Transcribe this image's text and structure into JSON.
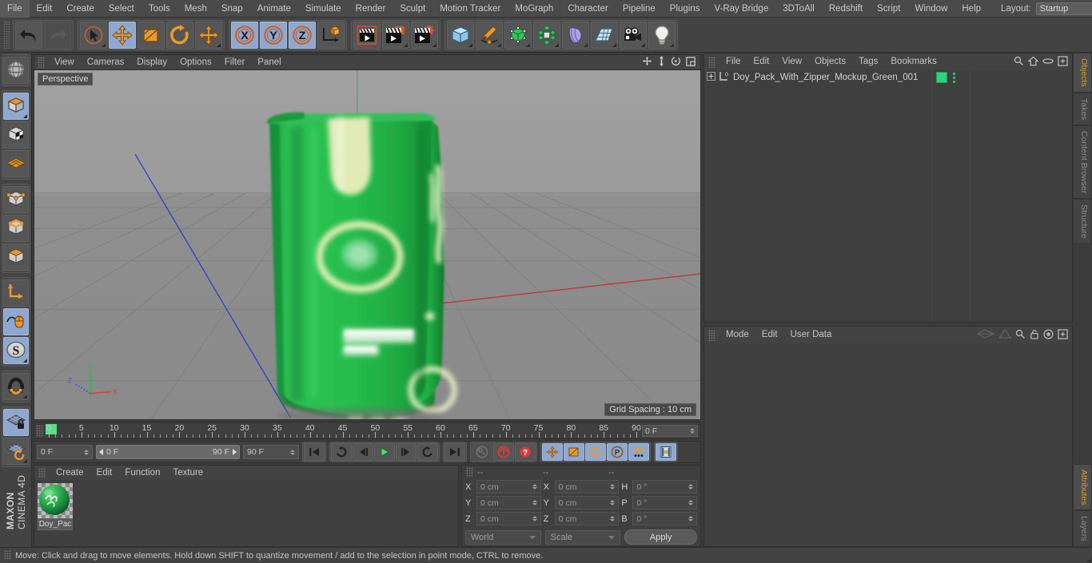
{
  "app": {
    "title": "Cinema 4D",
    "brand_top": "MAXON",
    "brand_bottom": "CINEMA 4D"
  },
  "menubar": {
    "items": [
      "File",
      "Edit",
      "Create",
      "Select",
      "Tools",
      "Mesh",
      "Snap",
      "Animate",
      "Simulate",
      "Render",
      "Sculpt",
      "Motion Tracker",
      "MoGraph",
      "Character",
      "Pipeline",
      "Plugins",
      "V-Ray Bridge",
      "3DToAll",
      "Redshift",
      "Script",
      "Window",
      "Help"
    ],
    "layout_label": "Layout:",
    "layout_value": "Startup",
    "search_icon": "search-icon"
  },
  "toolbar": {
    "groups": [
      {
        "name": "history",
        "buttons": [
          {
            "name": "undo",
            "icon": "undo-arrow-icon",
            "active": false,
            "dim": false,
            "corner": false
          },
          {
            "name": "redo",
            "icon": "redo-arrow-icon",
            "active": false,
            "dim": true,
            "corner": false
          }
        ]
      },
      {
        "name": "transform",
        "buttons": [
          {
            "name": "select",
            "icon": "cursor-select-icon",
            "active": false,
            "dim": false,
            "corner": true
          },
          {
            "name": "move",
            "icon": "move-arrows-icon",
            "active": true,
            "dim": false,
            "corner": false
          },
          {
            "name": "scale",
            "icon": "scale-box-icon",
            "active": false,
            "dim": false,
            "corner": false
          },
          {
            "name": "rotate",
            "icon": "rotate-arc-icon",
            "active": false,
            "dim": false,
            "corner": false
          },
          {
            "name": "move-alt",
            "icon": "move-arrows-icon",
            "active": false,
            "dim": false,
            "corner": true
          }
        ]
      },
      {
        "name": "axis-locks",
        "buttons": [
          {
            "name": "lock-x",
            "icon": "axis-x-icon",
            "active": true,
            "dim": false,
            "corner": false
          },
          {
            "name": "lock-y",
            "icon": "axis-y-icon",
            "active": true,
            "dim": false,
            "corner": false
          },
          {
            "name": "lock-z",
            "icon": "axis-z-icon",
            "active": true,
            "dim": false,
            "corner": false
          },
          {
            "name": "world-object-axis",
            "icon": "world-axis-cube-icon",
            "active": false,
            "dim": false,
            "corner": false
          }
        ]
      },
      {
        "name": "render",
        "buttons": [
          {
            "name": "render-view",
            "icon": "render-view-clapper-icon",
            "active": false,
            "dim": false,
            "corner": false
          },
          {
            "name": "render-to-picture-viewer",
            "icon": "render-picture-clapper-icon",
            "active": false,
            "dim": false,
            "corner": true
          },
          {
            "name": "render-settings",
            "icon": "render-settings-gear-clapper-icon",
            "active": false,
            "dim": false,
            "corner": true
          }
        ]
      },
      {
        "name": "create",
        "buttons": [
          {
            "name": "add-cube-primitive",
            "icon": "blue-cube-icon",
            "active": false,
            "dim": false,
            "corner": true
          },
          {
            "name": "add-spline",
            "icon": "pen-spline-icon",
            "active": false,
            "dim": false,
            "corner": true
          },
          {
            "name": "add-generator",
            "icon": "green-cube-nurbs-icon",
            "active": false,
            "dim": false,
            "corner": true
          },
          {
            "name": "add-array-modeling",
            "icon": "green-cluster-icon",
            "active": false,
            "dim": false,
            "corner": true
          },
          {
            "name": "add-bend-deformer",
            "icon": "purple-bend-deformer-icon",
            "active": false,
            "dim": false,
            "corner": true
          },
          {
            "name": "add-floor-environment",
            "icon": "floor-grid-icon",
            "active": false,
            "dim": false,
            "corner": true
          },
          {
            "name": "add-camera",
            "icon": "camera-icon",
            "active": false,
            "dim": false,
            "corner": true
          },
          {
            "name": "add-light",
            "icon": "light-bulb-icon",
            "active": false,
            "dim": false,
            "corner": true
          }
        ]
      }
    ]
  },
  "leftbar": {
    "groups": [
      {
        "buttons": [
          {
            "name": "make-editable",
            "icon": "globe-wire-icon",
            "active": false,
            "corner": false
          }
        ]
      },
      {
        "buttons": [
          {
            "name": "model-mode",
            "icon": "model-cube-icon",
            "active": true,
            "corner": true
          },
          {
            "name": "texture-mode",
            "icon": "texture-cube-icon",
            "active": false,
            "corner": false
          },
          {
            "name": "uv-mesh-mode",
            "icon": "uv-mesh-icon",
            "active": false,
            "corner": false
          }
        ]
      },
      {
        "buttons": [
          {
            "name": "points-mode",
            "icon": "points-cube-icon",
            "active": false,
            "corner": false
          },
          {
            "name": "edges-mode",
            "icon": "edges-cube-icon",
            "active": false,
            "corner": false
          },
          {
            "name": "polygons-mode",
            "icon": "polygons-cube-icon",
            "active": false,
            "corner": false
          }
        ]
      },
      {
        "buttons": [
          {
            "name": "object-axis-mode",
            "icon": "axis-corner-icon",
            "active": false,
            "corner": false
          },
          {
            "name": "viewport-solo-mode",
            "icon": "mouse-spline-icon",
            "active": true,
            "corner": false
          },
          {
            "name": "enable-snap",
            "icon": "snap-s-icon",
            "active": true,
            "corner": true
          }
        ]
      },
      {
        "buttons": [
          {
            "name": "magnet-tool",
            "icon": "magnet-icon",
            "active": false,
            "corner": true
          }
        ]
      },
      {
        "buttons": [
          {
            "name": "lock-workplane",
            "icon": "workplane-lock-icon",
            "active": true,
            "corner": false
          },
          {
            "name": "workplane-rotate",
            "icon": "workplane-rotate-icon",
            "active": false,
            "corner": true
          }
        ]
      }
    ]
  },
  "viewport": {
    "menu_items": [
      "View",
      "Cameras",
      "Display",
      "Options",
      "Filter",
      "Panel"
    ],
    "nav_icons": [
      "pan-icon",
      "dolly-icon",
      "orbit-icon",
      "maximize-viewport-icon"
    ],
    "label": "Perspective",
    "grid_spacing": "Grid Spacing : 10 cm",
    "axis_gizmo": {
      "x": "X",
      "y": "Y",
      "z": "Z"
    },
    "object_color": "#22b44a",
    "background_top": "#9a9a9a",
    "background_bottom": "#8e8e8e"
  },
  "timeline": {
    "ticks": [
      "0",
      "5",
      "10",
      "15",
      "20",
      "25",
      "30",
      "35",
      "40",
      "45",
      "50",
      "55",
      "60",
      "65",
      "70",
      "75",
      "80",
      "85",
      "90"
    ],
    "tick_min": 0,
    "tick_max": 90,
    "current_frame_field": "0 F",
    "start_frame": "0 F",
    "preview_min": "0 F",
    "preview_max": "90 F",
    "end_frame": "90 F",
    "transport": [
      {
        "name": "go-to-start",
        "icon": "skip-start-icon",
        "active": false
      },
      {
        "name": "play-backwards-loop",
        "icon": "loop-back-icon",
        "active": false
      },
      {
        "name": "step-back",
        "icon": "step-back-icon",
        "active": false
      },
      {
        "name": "play-forward",
        "icon": "play-icon",
        "active": false
      },
      {
        "name": "step-forward",
        "icon": "step-forward-icon",
        "active": false
      },
      {
        "name": "loop-forward",
        "icon": "loop-forward-icon",
        "active": false
      },
      {
        "name": "go-to-end",
        "icon": "skip-end-icon",
        "active": false
      }
    ],
    "keyframe_tools": [
      {
        "name": "record-active-objects",
        "icon": "key-icon",
        "active": false,
        "dim": true
      },
      {
        "name": "autokeying",
        "icon": "red-circle-arrows-icon",
        "active": false,
        "dim": false
      },
      {
        "name": "keyframe-selection",
        "icon": "red-question-icon",
        "active": false,
        "dim": false
      }
    ],
    "key_filters": [
      {
        "name": "position-key",
        "icon": "move-arrows-icon",
        "active": true
      },
      {
        "name": "scale-key",
        "icon": "scale-box-icon",
        "active": true
      },
      {
        "name": "rotation-key",
        "icon": "rotate-arc-icon",
        "active": true
      },
      {
        "name": "parameter-key",
        "icon": "parameter-p-icon",
        "active": true
      },
      {
        "name": "point-level-animation-key",
        "icon": "pla-dots-icon",
        "active": true
      }
    ],
    "extra": [
      {
        "name": "timeline-filmstrip",
        "icon": "filmstrip-icon",
        "active": true
      }
    ]
  },
  "material_manager": {
    "menu_items": [
      "Create",
      "Edit",
      "Function",
      "Texture"
    ],
    "materials": [
      {
        "name": "Doy_Pac",
        "color": "#2fa84f",
        "selected": true
      }
    ]
  },
  "coordinates": {
    "headers": [
      "--",
      "--",
      "--"
    ],
    "rows": [
      {
        "pos_label": "X",
        "pos_value": "0 cm",
        "size_label": "X",
        "size_value": "0 cm",
        "rot_label": "H",
        "rot_value": "0 °"
      },
      {
        "pos_label": "Y",
        "pos_value": "0 cm",
        "size_label": "Y",
        "size_value": "0 cm",
        "rot_label": "P",
        "rot_value": "0 °"
      },
      {
        "pos_label": "Z",
        "pos_value": "0 cm",
        "size_label": "Z",
        "size_value": "0 cm",
        "rot_label": "B",
        "rot_value": "0 °"
      }
    ],
    "system": "World",
    "mode": "Scale",
    "apply_label": "Apply"
  },
  "object_manager": {
    "menu_items": [
      "File",
      "Edit",
      "View",
      "Objects",
      "Tags",
      "Bookmarks"
    ],
    "header_icons": [
      "search-icon",
      "home-icon",
      "ellipse-icon",
      "add-layer-icon"
    ],
    "objects": [
      {
        "name": "Doy_Pack_With_Zipper_Mockup_Green_001",
        "expander": "+",
        "tag_color": "#2fd07e"
      }
    ]
  },
  "attribute_manager": {
    "menu_items": [
      "Mode",
      "Edit",
      "User Data"
    ],
    "header_icons": [
      "hierarchy-left-icon",
      "hierarchy-right-icon",
      "search-icon",
      "lock-icon",
      "target-icon",
      "add-icon"
    ]
  },
  "side_tabs_top": [
    "Objects",
    "Takes",
    "Content Browser",
    "Structure"
  ],
  "side_tabs_bottom": [
    "Attributes",
    "Layers"
  ],
  "status_bar": {
    "message": "Move: Click and drag to move elements. Hold down SHIFT to quantize movement / add to the selection in point mode, CTRL to remove."
  }
}
